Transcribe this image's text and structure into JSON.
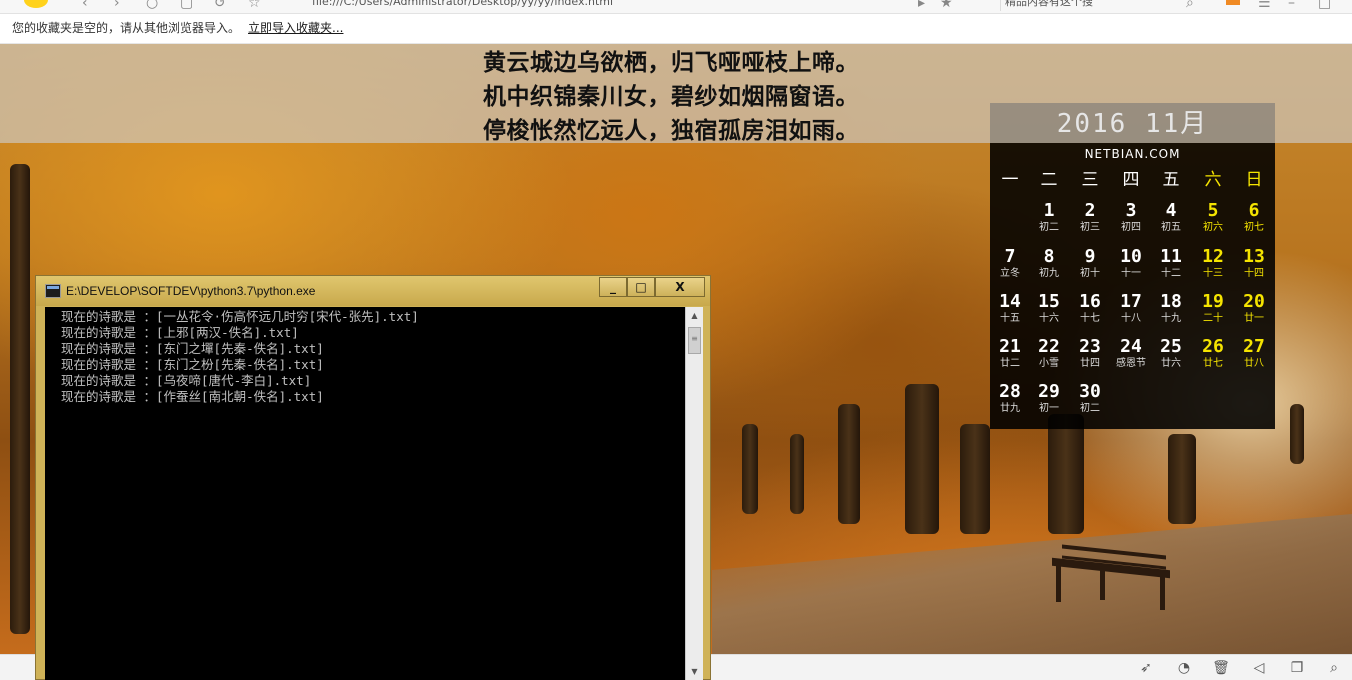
{
  "browser": {
    "address_text": "file:///C:/Users/Administrator/Desktop/yy/yy/index.html",
    "search_text": "精品内容有这个搜",
    "bookmarks_bar": {
      "message": "您的收藏夹是空的，请从其他浏览器导入。",
      "import_link": "立即导入收藏夹..."
    }
  },
  "poem": {
    "lines": [
      "黄云城边乌欲栖，归飞哑哑枝上啼。",
      "机中织锦秦川女，碧纱如烟隔窗语。",
      "停梭怅然忆远人，独宿孤房泪如雨。"
    ]
  },
  "calendar": {
    "title": "2016 11月",
    "site": "NETBIAN.COM",
    "weekdays": [
      "一",
      "二",
      "三",
      "四",
      "五",
      "六",
      "日"
    ],
    "weeks": [
      [
        null,
        {
          "d": "1",
          "l": "初二"
        },
        {
          "d": "2",
          "l": "初三"
        },
        {
          "d": "3",
          "l": "初四"
        },
        {
          "d": "4",
          "l": "初五"
        },
        {
          "d": "5",
          "l": "初六"
        },
        {
          "d": "6",
          "l": "初七"
        }
      ],
      [
        {
          "d": "7",
          "l": "立冬"
        },
        {
          "d": "8",
          "l": "初九"
        },
        {
          "d": "9",
          "l": "初十"
        },
        {
          "d": "10",
          "l": "十一"
        },
        {
          "d": "11",
          "l": "十二"
        },
        {
          "d": "12",
          "l": "十三"
        },
        {
          "d": "13",
          "l": "十四"
        }
      ],
      [
        {
          "d": "14",
          "l": "十五"
        },
        {
          "d": "15",
          "l": "十六"
        },
        {
          "d": "16",
          "l": "十七"
        },
        {
          "d": "17",
          "l": "十八"
        },
        {
          "d": "18",
          "l": "十九"
        },
        {
          "d": "19",
          "l": "二十"
        },
        {
          "d": "20",
          "l": "廿一"
        }
      ],
      [
        {
          "d": "21",
          "l": "廿二"
        },
        {
          "d": "22",
          "l": "小雪"
        },
        {
          "d": "23",
          "l": "廿四"
        },
        {
          "d": "24",
          "l": "感恩节"
        },
        {
          "d": "25",
          "l": "廿六"
        },
        {
          "d": "26",
          "l": "廿七"
        },
        {
          "d": "27",
          "l": "廿八"
        }
      ],
      [
        {
          "d": "28",
          "l": "廿九"
        },
        {
          "d": "29",
          "l": "初一"
        },
        {
          "d": "30",
          "l": "初二"
        },
        null,
        null,
        null,
        null
      ]
    ],
    "weekend_color": "#f5e400"
  },
  "console": {
    "title": "E:\\DEVELOP\\SOFTDEV\\python3.7\\python.exe",
    "buttons": {
      "minimize": "_",
      "maximize": "□",
      "close": "X"
    },
    "lines": [
      "现在的诗歌是  ：[一丛花令·伤高怀远几时穷[宋代-张先].txt]",
      "现在的诗歌是  ：[上邪[两汉-佚名].txt]",
      "现在的诗歌是  ：[东门之墠[先秦-佚名].txt]",
      "现在的诗歌是  ：[东门之枌[先秦-佚名].txt]",
      "现在的诗歌是  ：[乌夜啼[唐代-李白].txt]",
      "现在的诗歌是  ：[作蚕丝[南北朝-佚名].txt]"
    ]
  },
  "statusbar": {
    "icons": [
      "rocket-icon",
      "speedometer-icon",
      "trash-icon",
      "speaker-icon",
      "window-icon",
      "zoom-icon"
    ]
  }
}
